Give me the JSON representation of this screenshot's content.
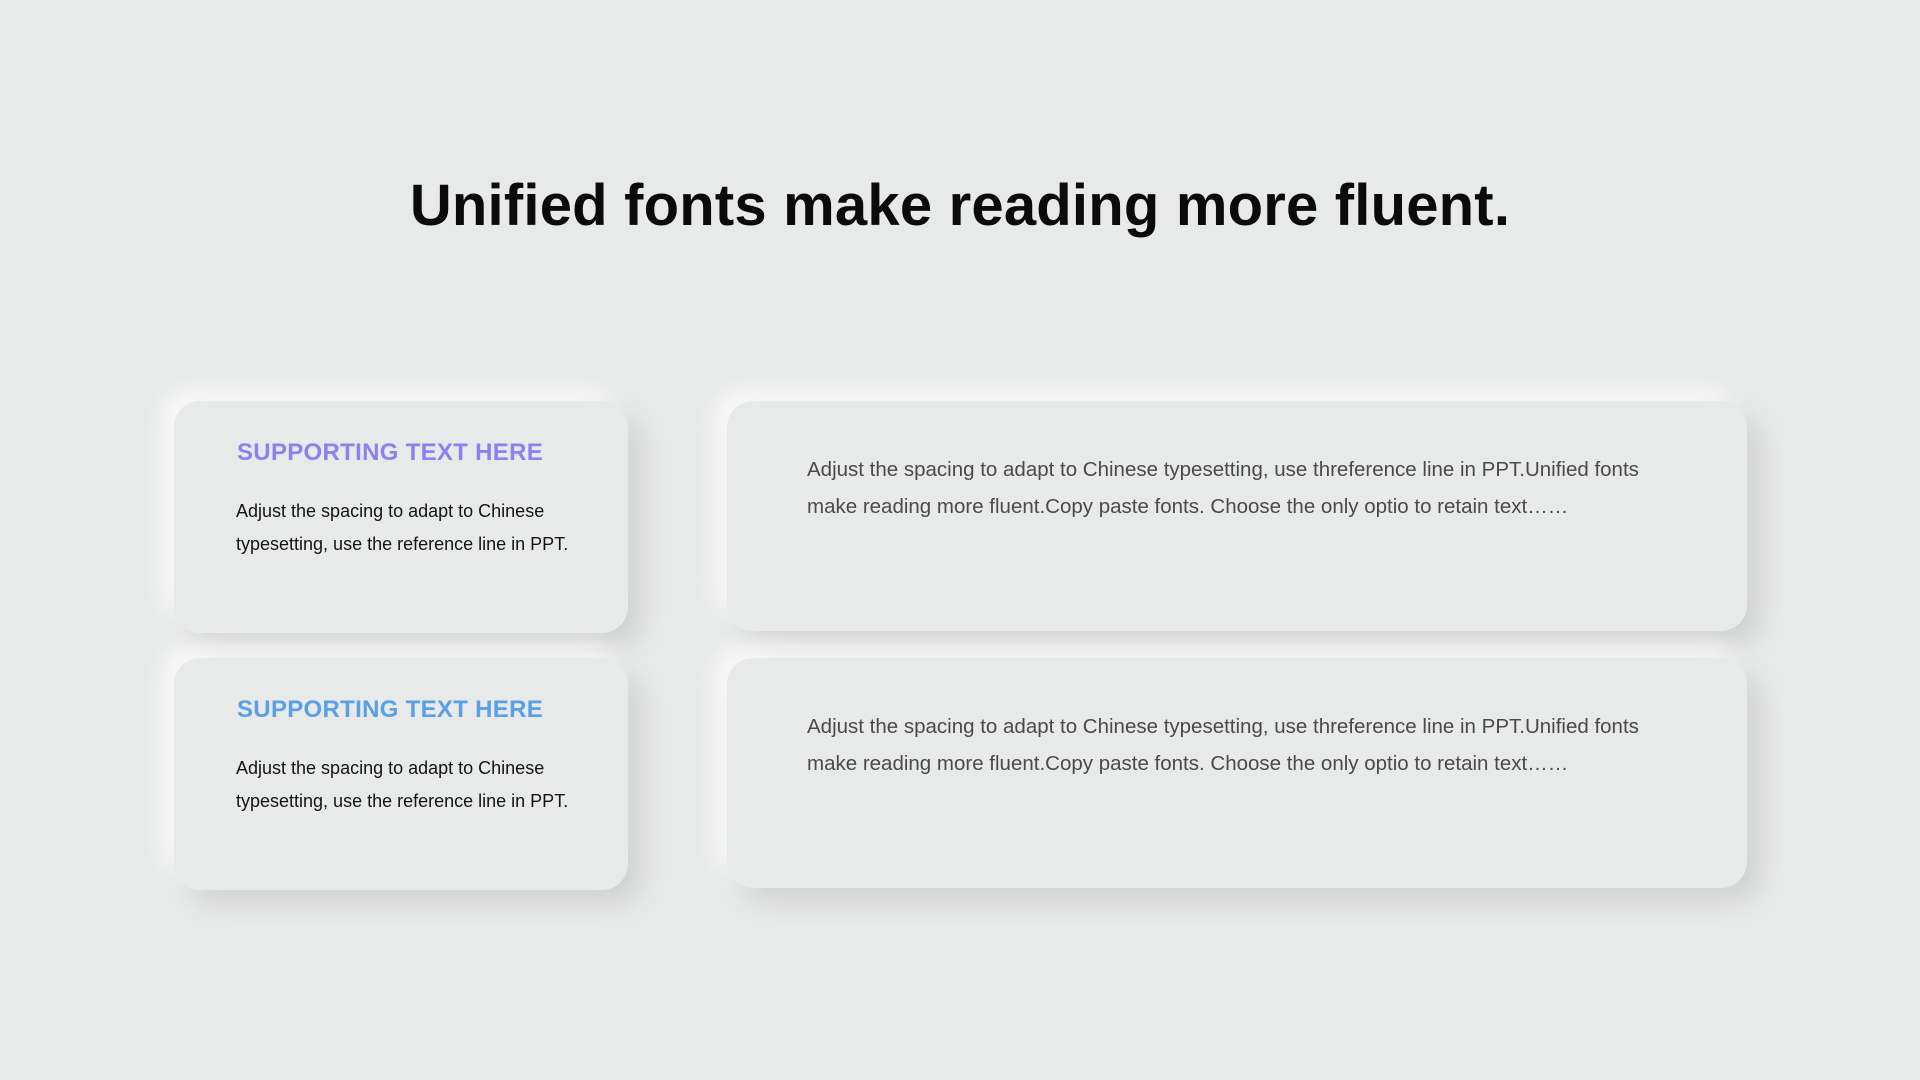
{
  "slide": {
    "title": "Unified fonts make reading more fluent."
  },
  "cards": {
    "left": [
      {
        "heading": "SUPPORTING TEXT HERE",
        "heading_color": "#8f7ff0",
        "body": "Adjust the spacing to adapt to Chinese typesetting, use the reference line in PPT."
      },
      {
        "heading": "SUPPORTING TEXT HERE",
        "heading_color": "#5aa0e8",
        "body": "Adjust the spacing to adapt to Chinese typesetting, use the reference line in PPT."
      }
    ],
    "right": [
      {
        "body": "Adjust the spacing to adapt to Chinese typesetting, use threference line in PPT.Unified fonts make reading more fluent.Copy paste fonts. Choose the only optio to retain text……"
      },
      {
        "body": "Adjust the spacing to adapt to Chinese typesetting, use threference line in PPT.Unified fonts make reading more fluent.Copy paste fonts. Choose the only optio to retain text……"
      }
    ]
  },
  "colors": {
    "background": "#e8e9e9",
    "title": "#0b0b0b",
    "body_dark": "#141414",
    "body_gray": "#4a4a4a"
  }
}
